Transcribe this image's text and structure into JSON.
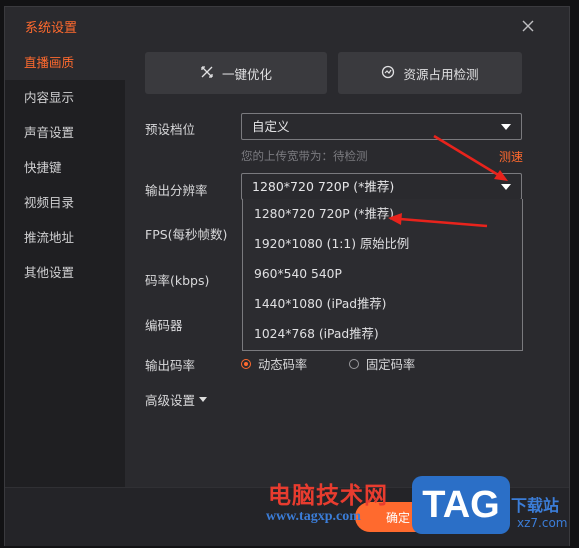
{
  "window": {
    "title": "系统设置"
  },
  "sidebar": {
    "items": [
      {
        "label": "直播画质",
        "active": true
      },
      {
        "label": "内容显示"
      },
      {
        "label": "声音设置"
      },
      {
        "label": "快捷键"
      },
      {
        "label": "视频目录"
      },
      {
        "label": "推流地址"
      },
      {
        "label": "其他设置"
      }
    ]
  },
  "actions": {
    "optimize_label": "一键优化",
    "detect_label": "资源占用检测"
  },
  "preset": {
    "label": "预设档位",
    "value": "自定义",
    "hint": "您的上传宽带为：待检测",
    "speed_test": "测速"
  },
  "resolution": {
    "label": "输出分辨率",
    "value": "1280*720 720P (*推荐)",
    "options": [
      "1280*720 720P (*推荐)",
      "1920*1080 (1:1) 原始比例",
      "960*540 540P",
      "1440*1080 (iPad推荐)",
      "1024*768 (iPad推荐)"
    ]
  },
  "fps": {
    "label": "FPS(每秒帧数)"
  },
  "bitrate": {
    "label": "码率(kbps)"
  },
  "encoder": {
    "label": "编码器"
  },
  "output_rate": {
    "label": "输出码率",
    "dynamic": "动态码率",
    "fixed": "固定码率",
    "selected": "dynamic"
  },
  "advanced": {
    "label": "高级设置"
  },
  "footer": {
    "confirm_label": "确定"
  },
  "watermark": {
    "cn": "电脑技术网",
    "url": "www.tagxp.com",
    "tag": "TAG",
    "dl": "下载站",
    "sub": "xz7.com"
  },
  "colors": {
    "accent": "#ff6a2e",
    "arrow": "#e8231c",
    "panel": "#2a2a2e",
    "sidebar": "#1f1f22"
  }
}
